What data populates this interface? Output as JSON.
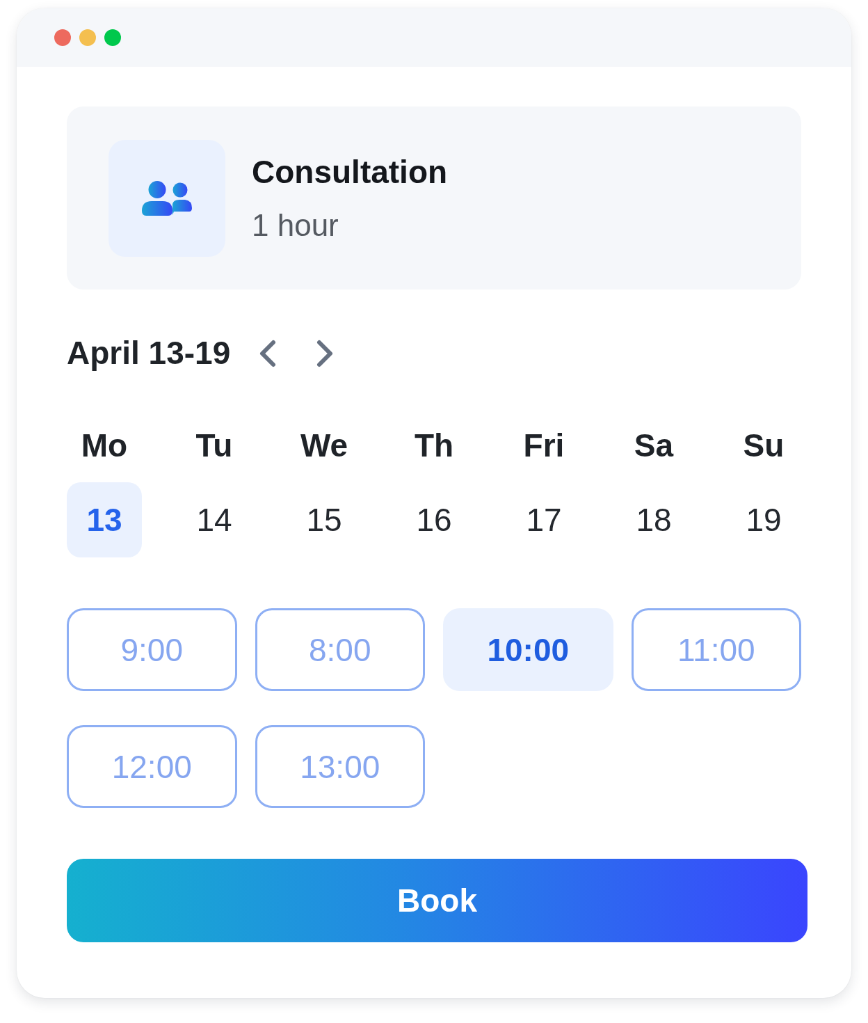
{
  "window": {
    "controls": [
      {
        "color": "#ed6a5e"
      },
      {
        "color": "#f4bf4f"
      },
      {
        "color": "#00c84c"
      }
    ]
  },
  "service": {
    "title": "Consultation",
    "duration": "1 hour"
  },
  "week": {
    "label": "April 13-19"
  },
  "days": [
    {
      "name": "Mo",
      "date": "13",
      "selected": true
    },
    {
      "name": "Tu",
      "date": "14",
      "selected": false
    },
    {
      "name": "We",
      "date": "15",
      "selected": false
    },
    {
      "name": "Th",
      "date": "16",
      "selected": false
    },
    {
      "name": "Fri",
      "date": "17",
      "selected": false
    },
    {
      "name": "Sa",
      "date": "18",
      "selected": false
    },
    {
      "name": "Su",
      "date": "19",
      "selected": false
    }
  ],
  "time_slots": [
    {
      "label": "9:00",
      "selected": false
    },
    {
      "label": "8:00",
      "selected": false
    },
    {
      "label": "10:00",
      "selected": true
    },
    {
      "label": "11:00",
      "selected": false
    },
    {
      "label": "12:00",
      "selected": false
    },
    {
      "label": "13:00",
      "selected": false
    }
  ],
  "book_button": {
    "label": "Book"
  }
}
